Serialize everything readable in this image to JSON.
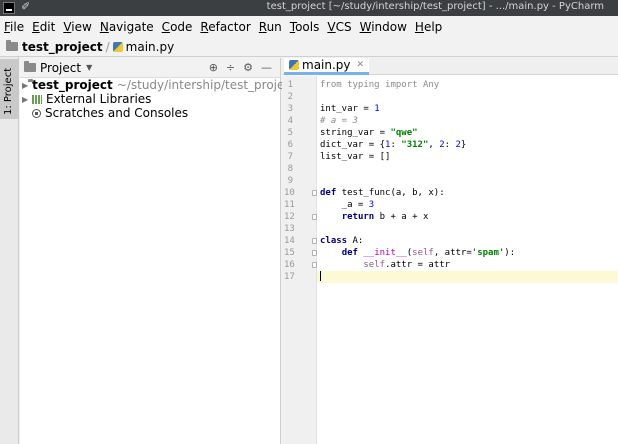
{
  "window": {
    "title": "test_project [~/study/intership/test_project] - .../main.py - PyCharm"
  },
  "menu": [
    "File",
    "Edit",
    "View",
    "Navigate",
    "Code",
    "Refactor",
    "Run",
    "Tools",
    "VCS",
    "Window",
    "Help"
  ],
  "breadcrumb": {
    "project": "test_project",
    "separator": "/",
    "file": "main.py"
  },
  "side_strip": {
    "label": "1: Project"
  },
  "project_panel": {
    "title": "Project",
    "tools": [
      "⊕",
      "÷",
      "⚙",
      "—"
    ],
    "tree": [
      {
        "name": "test_project",
        "path": "~/study/intership/test_project"
      },
      {
        "name": "External Libraries"
      },
      {
        "name": "Scratches and Consoles"
      }
    ]
  },
  "editor": {
    "tab": {
      "label": "main.py",
      "close": "✕"
    },
    "line_numbers": [
      "1",
      "2",
      "3",
      "4",
      "5",
      "6",
      "7",
      "8",
      "9",
      "10",
      "11",
      "12",
      "13",
      "14",
      "15",
      "16",
      "17"
    ],
    "lines": [
      [
        {
          "t": "from typing import Any",
          "c": "dim"
        }
      ],
      [],
      [
        {
          "t": "int_var = "
        },
        {
          "t": "1",
          "c": "num"
        }
      ],
      [
        {
          "t": "# a = 3",
          "c": "cmt"
        }
      ],
      [
        {
          "t": "string_var = "
        },
        {
          "t": "\"qwe\"",
          "c": "str"
        }
      ],
      [
        {
          "t": "dict_var = {"
        },
        {
          "t": "1",
          "c": "num"
        },
        {
          "t": ": "
        },
        {
          "t": "\"312\"",
          "c": "str"
        },
        {
          "t": ", "
        },
        {
          "t": "2",
          "c": "num"
        },
        {
          "t": ": "
        },
        {
          "t": "2",
          "c": "num"
        },
        {
          "t": "}"
        }
      ],
      [
        {
          "t": "list_var = []"
        }
      ],
      [],
      [],
      [
        {
          "t": "def",
          "c": "kw"
        },
        {
          "t": " test_func(a, b, x):"
        }
      ],
      [
        {
          "t": "    _a = "
        },
        {
          "t": "3",
          "c": "num"
        }
      ],
      [
        {
          "t": "    "
        },
        {
          "t": "return",
          "c": "kw"
        },
        {
          "t": " b + a + x"
        }
      ],
      [],
      [
        {
          "t": "class",
          "c": "kw"
        },
        {
          "t": " A:"
        }
      ],
      [
        {
          "t": "    "
        },
        {
          "t": "def",
          "c": "kw"
        },
        {
          "t": " "
        },
        {
          "t": "__init__",
          "c": "magic"
        },
        {
          "t": "("
        },
        {
          "t": "self",
          "c": "self"
        },
        {
          "t": ", attr="
        },
        {
          "t": "'spam'",
          "c": "str"
        },
        {
          "t": "):"
        }
      ],
      [
        {
          "t": "        "
        },
        {
          "t": "self",
          "c": "self"
        },
        {
          "t": ".attr = attr"
        }
      ],
      []
    ],
    "fold_markers": [
      "10",
      "12",
      "14",
      "15",
      "16"
    ],
    "intention_bulb_line": "16",
    "current_line": "17"
  },
  "colors": {
    "keyword": "#000080",
    "string": "#008000",
    "number": "#0000ff",
    "comment": "#8c8c8c",
    "self": "#94558d",
    "caret_line": "#fcfad5",
    "tab_underline": "#7ab1ec"
  }
}
